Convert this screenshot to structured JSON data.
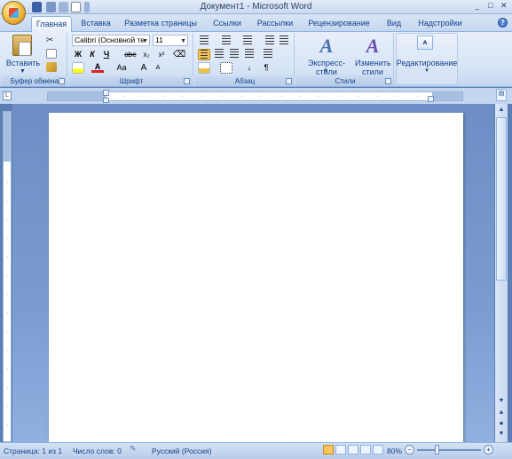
{
  "window": {
    "title": "Документ1 - Microsoft Word"
  },
  "tabs": [
    {
      "label": "Главная",
      "active": true
    },
    {
      "label": "Вставка"
    },
    {
      "label": "Разметка страницы"
    },
    {
      "label": "Ссылки"
    },
    {
      "label": "Рассылки"
    },
    {
      "label": "Рецензирование"
    },
    {
      "label": "Вид"
    },
    {
      "label": "Надстройки"
    }
  ],
  "clipboard": {
    "paste_label": "Вставить",
    "group_label": "Буфер обмена"
  },
  "font": {
    "name_value": "Calibri (Основной те",
    "size_value": "11",
    "bold": "Ж",
    "italic": "К",
    "underline": "Ч",
    "strike": "abe",
    "subscript": "x₂",
    "superscript": "x²",
    "grow": "A",
    "shrink": "A",
    "case": "Aa",
    "color_a": "A",
    "group_label": "Шрифт"
  },
  "paragraph": {
    "group_label": "Абзац",
    "marks": "¶"
  },
  "styles": {
    "express_label": "Экспресс-стили",
    "change_label": "Изменить стили",
    "group_label": "Стили"
  },
  "editing": {
    "label": "Редактирование"
  },
  "status": {
    "page": "Страница: 1 из 1",
    "words": "Число слов: 0",
    "language": "Русский (Россия)",
    "zoom": "80%"
  },
  "colors": {
    "accent": "#15428b",
    "highlight": "#f8c65c",
    "font_color": "#e02020"
  }
}
